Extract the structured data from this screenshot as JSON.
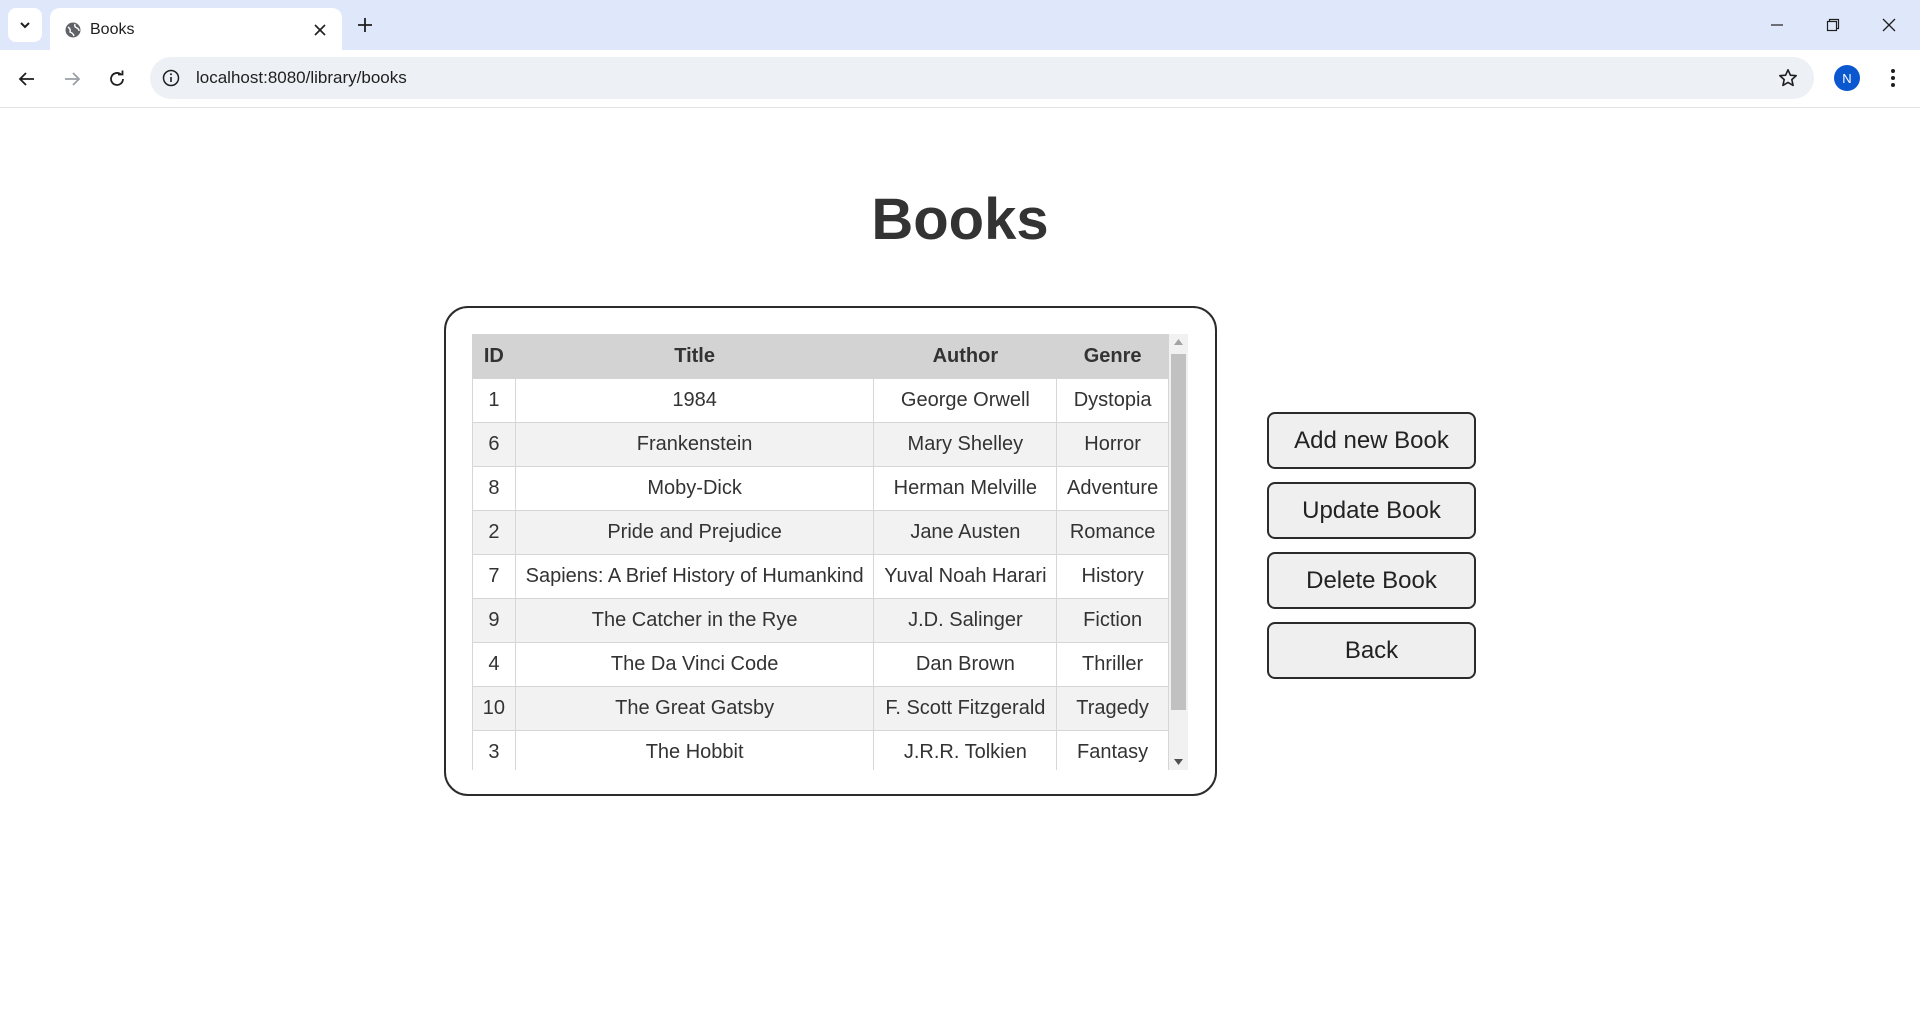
{
  "browser": {
    "tab_title": "Books",
    "url": "localhost:8080/library/books",
    "profile_initial": "N",
    "icons": [
      "tab-search-icon",
      "globe-icon",
      "close-icon",
      "plus-icon",
      "minimize-icon",
      "restore-icon",
      "close-window-icon",
      "back-arrow-icon",
      "forward-arrow-icon",
      "reload-icon",
      "site-info-icon",
      "star-icon",
      "kebab-menu-icon"
    ]
  },
  "page": {
    "title": "Books"
  },
  "table": {
    "headers": {
      "id": "ID",
      "title": "Title",
      "author": "Author",
      "genre": "Genre"
    },
    "rows": [
      {
        "id": "1",
        "title": "1984",
        "author": "George Orwell",
        "genre": "Dystopia"
      },
      {
        "id": "6",
        "title": "Frankenstein",
        "author": "Mary Shelley",
        "genre": "Horror"
      },
      {
        "id": "8",
        "title": "Moby-Dick",
        "author": "Herman Melville",
        "genre": "Adventure"
      },
      {
        "id": "2",
        "title": "Pride and Prejudice",
        "author": "Jane Austen",
        "genre": "Romance"
      },
      {
        "id": "7",
        "title": "Sapiens: A Brief History of Humankind",
        "author": "Yuval Noah Harari",
        "genre": "History"
      },
      {
        "id": "9",
        "title": "The Catcher in the Rye",
        "author": "J.D. Salinger",
        "genre": "Fiction"
      },
      {
        "id": "4",
        "title": "The Da Vinci Code",
        "author": "Dan Brown",
        "genre": "Thriller"
      },
      {
        "id": "10",
        "title": "The Great Gatsby",
        "author": "F. Scott Fitzgerald",
        "genre": "Tragedy"
      },
      {
        "id": "3",
        "title": "The Hobbit",
        "author": "J.R.R. Tolkien",
        "genre": "Fantasy"
      }
    ]
  },
  "actions": {
    "add": "Add new Book",
    "update": "Update Book",
    "delete": "Delete Book",
    "back": "Back"
  },
  "colors": {
    "tabstrip_bg": "#dfe8fb",
    "omnibox_bg": "#edf0f5",
    "avatar_bg": "#0b57d0",
    "header_bg": "#d3d3d3",
    "stripe_bg": "#f2f2f2",
    "button_bg": "#efefef"
  }
}
